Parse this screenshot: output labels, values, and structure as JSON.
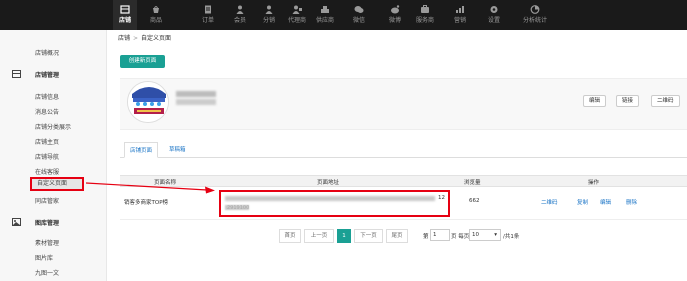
{
  "topnav": {
    "items": [
      {
        "label": "店铺",
        "icon": "store-icon",
        "active": true
      },
      {
        "label": "商品",
        "icon": "goods-icon"
      },
      {
        "label": "订单",
        "icon": "order-icon"
      },
      {
        "label": "会员",
        "icon": "member-icon"
      },
      {
        "label": "分销",
        "icon": "distribution-icon"
      },
      {
        "label": "代理商",
        "icon": "agent-icon"
      },
      {
        "label": "供应商",
        "icon": "supplier-icon"
      },
      {
        "label": "微信",
        "icon": "wechat-icon"
      },
      {
        "label": "微博",
        "icon": "weibo-icon"
      },
      {
        "label": "服务商",
        "icon": "service-provider-icon"
      },
      {
        "label": "营销",
        "icon": "marketing-icon"
      },
      {
        "label": "设置",
        "icon": "settings-icon"
      },
      {
        "label": "分析统计",
        "icon": "analytics-icon"
      }
    ]
  },
  "sidebar": {
    "overview": "店铺概况",
    "group1": "店铺管理",
    "items1": [
      "店铺信息",
      "消息公告",
      "店铺分类展示",
      "店铺主页",
      "店铺导航",
      "在线客服",
      "自定义页面",
      "同店管家"
    ],
    "group2": "图库管理",
    "items2": [
      "素材管理",
      "图片库",
      "九图一文"
    ]
  },
  "breadcrumb": {
    "root": "店铺",
    "sep": ">",
    "current": "自定义页面"
  },
  "actions": {
    "create": "创建新页面"
  },
  "shop_card": {
    "buttons": [
      "编辑",
      "链接",
      "二维码"
    ]
  },
  "tabs": [
    "店铺页面",
    "草稿箱"
  ],
  "table": {
    "headers": [
      "页面名称",
      "页面地址",
      "浏览量",
      "操作"
    ],
    "rows": [
      {
        "name": "销客多商家TOP榜",
        "address_tail": "12",
        "address_line2": "2919100",
        "views": "662",
        "ops": [
          "二维码",
          "复制",
          "编辑",
          "删除"
        ]
      }
    ]
  },
  "pager": {
    "first": "首页",
    "prev": "上一页",
    "current": "1",
    "next": "下一页",
    "last": "尾页",
    "jump_prefix": "第",
    "jump_value": "1",
    "jump_suffix": "页 每页",
    "per_page": "10",
    "total": "/共1条"
  },
  "colors": {
    "accent": "#1aa094",
    "highlight": "#e60012",
    "link": "#1a74c6",
    "nav_bg": "#1a1a1a"
  }
}
